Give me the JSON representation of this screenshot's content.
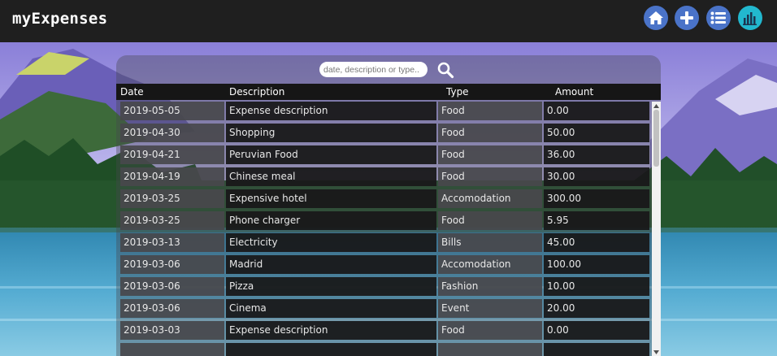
{
  "app": {
    "title": "myExpenses"
  },
  "nav": [
    {
      "name": "home-button",
      "icon": "home-icon",
      "color": "#4a73c8"
    },
    {
      "name": "add-expense-button",
      "icon": "plus-icon",
      "color": "#4a73c8"
    },
    {
      "name": "list-button",
      "icon": "list-icon",
      "color": "#4a73c8"
    },
    {
      "name": "stats-button",
      "icon": "bar-chart-icon",
      "color": "#22b8cf"
    }
  ],
  "search": {
    "placeholder": "date, description or type.."
  },
  "table": {
    "headers": {
      "date": "Date",
      "description": "Description",
      "type": "Type",
      "amount": "Amount"
    },
    "rows": [
      {
        "date": "2019-05-05",
        "description": "Expense description",
        "type": "Food",
        "amount": "0.00"
      },
      {
        "date": "2019-04-30",
        "description": "Shopping",
        "type": "Food",
        "amount": "50.00"
      },
      {
        "date": "2019-04-21",
        "description": "Peruvian Food",
        "type": "Food",
        "amount": "36.00"
      },
      {
        "date": "2019-04-19",
        "description": "Chinese meal",
        "type": "Food",
        "amount": "30.00"
      },
      {
        "date": "2019-03-25",
        "description": "Expensive hotel",
        "type": "Accomodation",
        "amount": "300.00"
      },
      {
        "date": "2019-03-25",
        "description": "Phone charger",
        "type": "Food",
        "amount": "5.95"
      },
      {
        "date": "2019-03-13",
        "description": "Electricity",
        "type": "Bills",
        "amount": "45.00"
      },
      {
        "date": "2019-03-06",
        "description": "Madrid",
        "type": "Accomodation",
        "amount": "100.00"
      },
      {
        "date": "2019-03-06",
        "description": "Pizza",
        "type": "Fashion",
        "amount": "10.00"
      },
      {
        "date": "2019-03-06",
        "description": "Cinema",
        "type": "Event",
        "amount": "20.00"
      },
      {
        "date": "2019-03-03",
        "description": "Expense description",
        "type": "Food",
        "amount": "0.00"
      }
    ]
  }
}
